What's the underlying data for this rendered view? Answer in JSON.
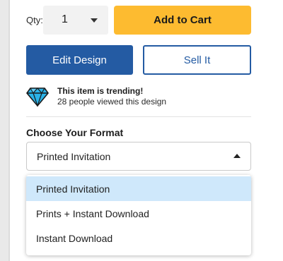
{
  "quantity": {
    "label": "Qty:",
    "value": "1"
  },
  "actions": {
    "add_to_cart": "Add to Cart",
    "edit_design": "Edit Design",
    "sell_it": "Sell It"
  },
  "trending": {
    "icon": "diamond-icon",
    "title": "This item is trending!",
    "subtitle": "28 people viewed this design"
  },
  "format": {
    "heading": "Choose Your Format",
    "selected": "Printed Invitation",
    "options": [
      {
        "label": "Printed Invitation",
        "highlighted": true
      },
      {
        "label": "Prints + Instant Download",
        "highlighted": false
      },
      {
        "label": "Instant Download",
        "highlighted": false
      }
    ]
  },
  "colors": {
    "primary_blue": "#245ba3",
    "cart_yellow": "#fdbb30",
    "option_highlight": "#cfe8fb",
    "diamond_blue": "#2bb3e8"
  }
}
